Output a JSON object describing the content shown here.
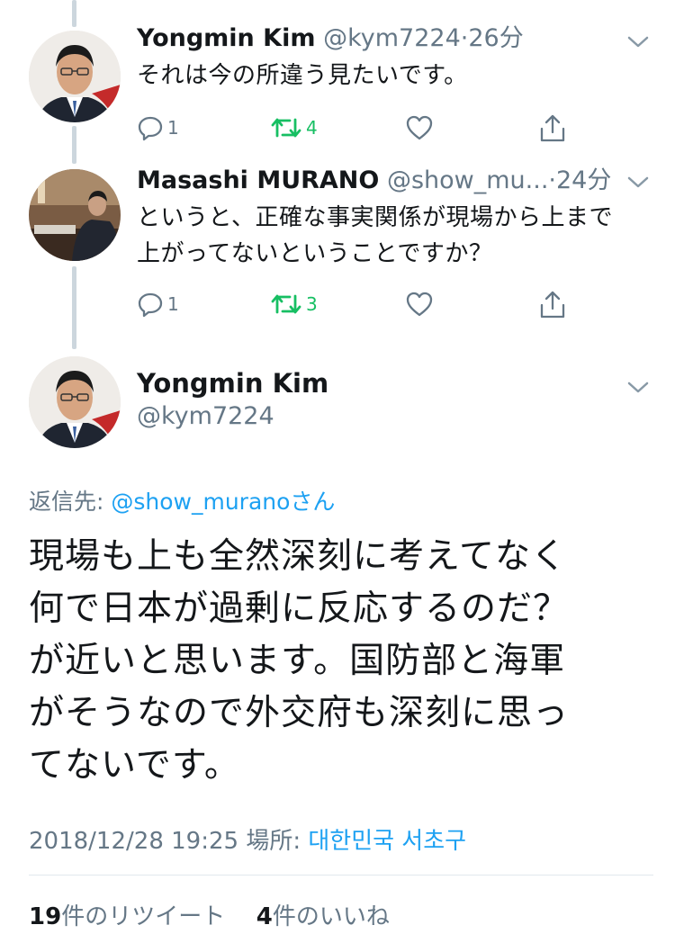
{
  "tweets": [
    {
      "name": "Yongmin Kim",
      "handle": "@kym7224",
      "separator": "·",
      "time": "26分",
      "text": "それは今の所違う見たいです。",
      "replies": "1",
      "retweets": "4"
    },
    {
      "name": "Masashi MURANO",
      "handle": "@show_mu...",
      "separator": "·",
      "time": "24分",
      "text_line1": "というと、正確な事実関係が現場から上まで",
      "text_line2": "上がってないということですか？",
      "replies": "1",
      "retweets": "3"
    }
  ],
  "main_tweet": {
    "name": "Yongmin Kim",
    "handle": "@kym7224",
    "replying_label": "返信先: ",
    "replying_to": "@show_muranoさん",
    "lines": [
      "現場も上も全然深刻に考えてなく",
      "何で日本が過剰に反応するのだ？",
      "が近いと思います。国防部と海軍",
      "がそうなので外交府も深刻に思っ",
      "てないです。"
    ],
    "timestamp": "2018/12/28 19:25",
    "location_label": "場所: ",
    "location": "대한민국 서초구",
    "retweet_count": "19",
    "retweet_label": "件のリツイート",
    "like_count": "4",
    "like_label": "件のいいね"
  },
  "colors": {
    "text": "#14171a",
    "muted": "#657786",
    "link": "#1da1f2",
    "retweet": "#17bf63",
    "thread_line": "#ccd6dd"
  },
  "icons": [
    "chevron-down-icon",
    "reply-icon",
    "retweet-icon",
    "like-icon",
    "share-icon"
  ]
}
